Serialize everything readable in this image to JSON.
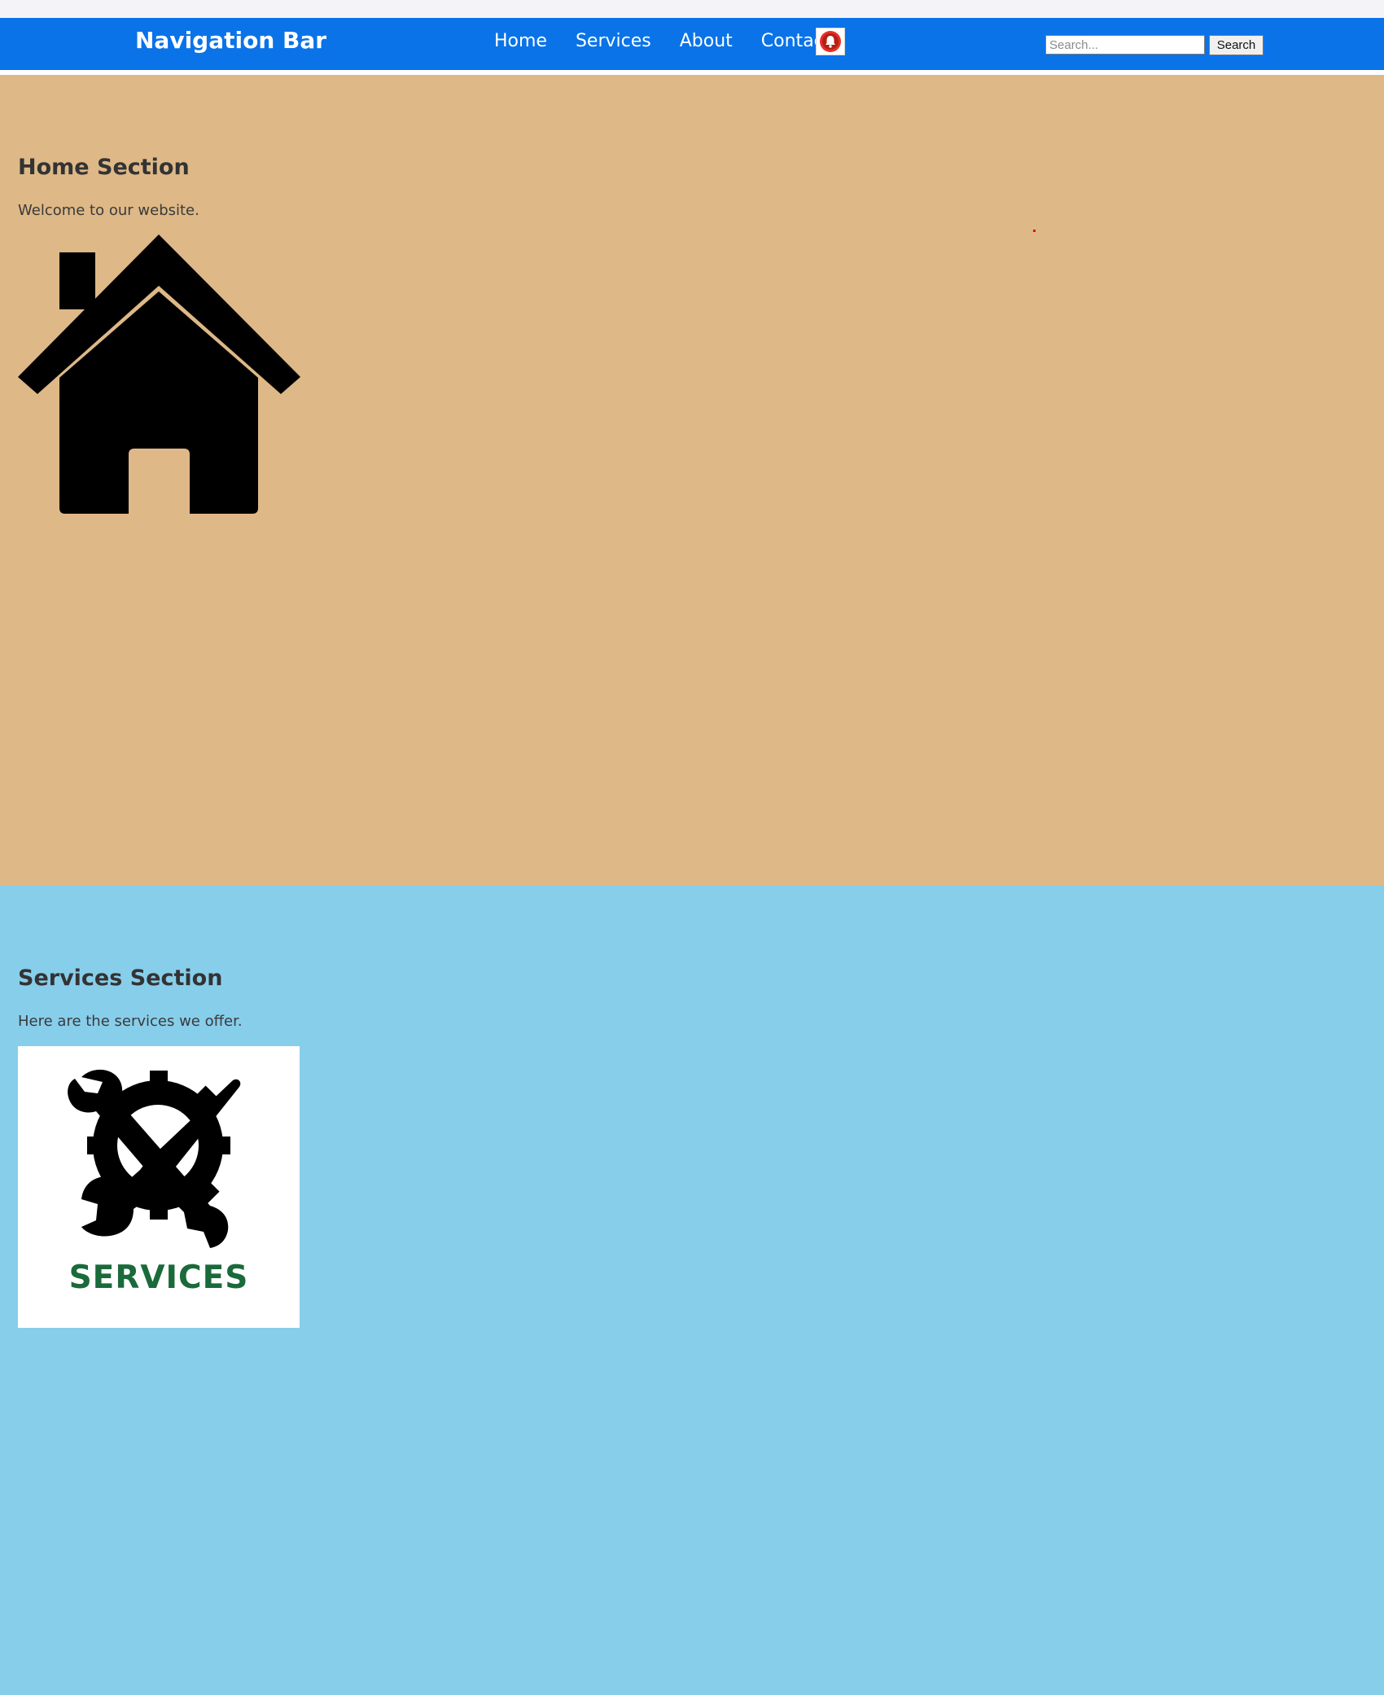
{
  "navbar": {
    "brand": "Navigation Bar",
    "links": [
      {
        "label": "Home"
      },
      {
        "label": "Services"
      },
      {
        "label": "About"
      },
      {
        "label": "Contact"
      }
    ],
    "notification_icon": "bell-icon",
    "search": {
      "value": "",
      "placeholder": "Search...",
      "button_label": "Search"
    },
    "color": "#0a73e8"
  },
  "home": {
    "title": "Home Section",
    "text": "Welcome to our website.",
    "image_icon": "house-icon",
    "background": "#deb887"
  },
  "services": {
    "title": "Services Section",
    "text": "Here are the services we offer.",
    "image_icon": "services-gear-tools-icon",
    "image_word": "SERVICES",
    "background": "#87ceeb"
  }
}
